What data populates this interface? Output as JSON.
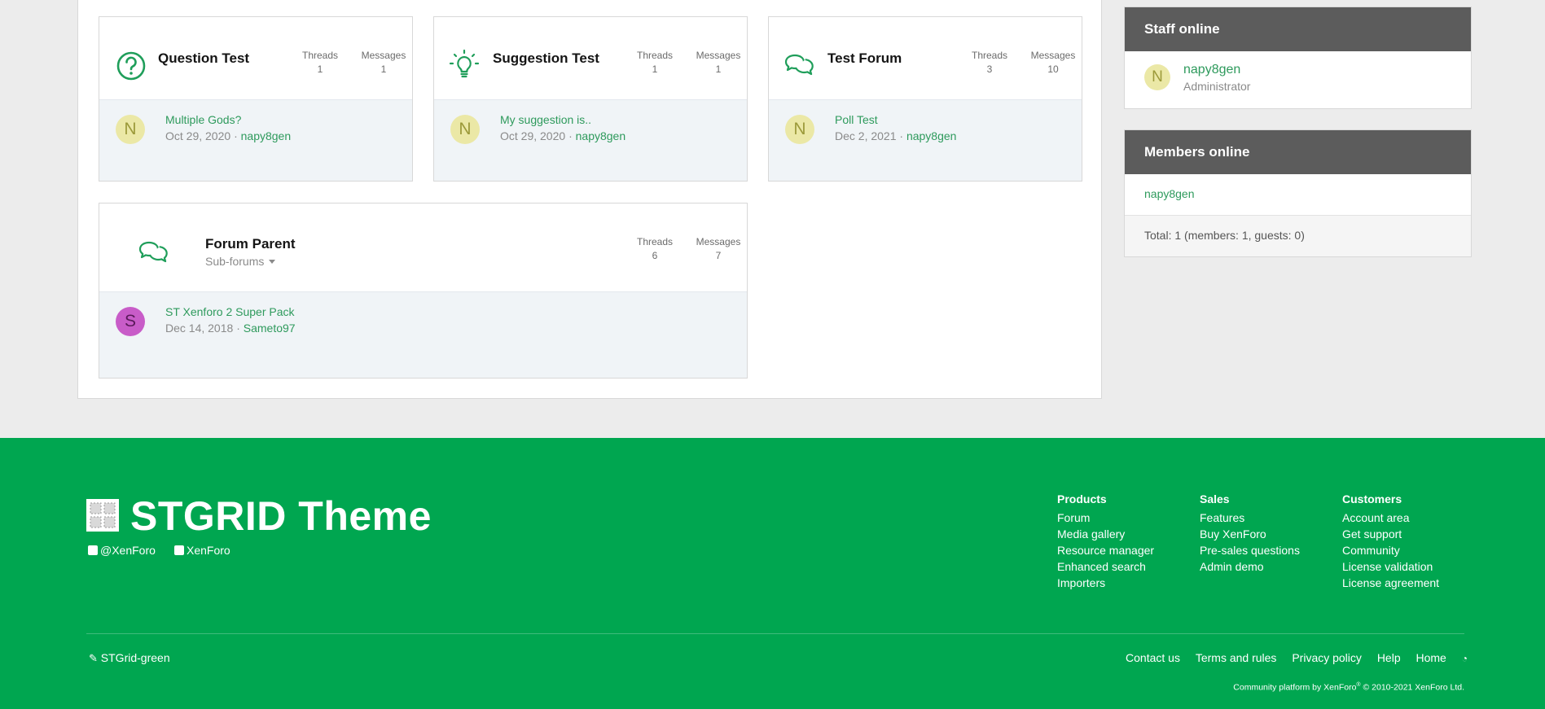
{
  "forums": [
    {
      "title": "Question Test",
      "threads_label": "Threads",
      "threads": "1",
      "messages_label": "Messages",
      "messages": "1",
      "last_title": "Multiple Gods?",
      "last_date": "Oct 29, 2020",
      "last_sep": "·",
      "last_user": "napy8gen",
      "avatar_letter": "N",
      "icon": "question-circle-icon"
    },
    {
      "title": "Suggestion Test",
      "threads_label": "Threads",
      "threads": "1",
      "messages_label": "Messages",
      "messages": "1",
      "last_title": "My suggestion is..",
      "last_date": "Oct 29, 2020",
      "last_sep": "·",
      "last_user": "napy8gen",
      "avatar_letter": "N",
      "icon": "lightbulb-icon"
    },
    {
      "title": "Test Forum",
      "threads_label": "Threads",
      "threads": "3",
      "messages_label": "Messages",
      "messages": "10",
      "last_title": "Poll Test",
      "last_date": "Dec 2, 2021",
      "last_sep": "·",
      "last_user": "napy8gen",
      "avatar_letter": "N",
      "icon": "chat-bubbles-icon"
    },
    {
      "title": "Forum Parent",
      "subforums": "Sub-forums",
      "threads_label": "Threads",
      "threads": "6",
      "messages_label": "Messages",
      "messages": "7",
      "last_title": "ST Xenforo 2 Super Pack",
      "last_date": "Dec 14, 2018",
      "last_sep": "·",
      "last_user": "Sameto97",
      "avatar_letter": "S",
      "icon": "chat-bubbles-icon"
    }
  ],
  "sidebar": {
    "staff_title": "Staff online",
    "staff_user": "napy8gen",
    "staff_role": "Administrator",
    "staff_avatar_letter": "N",
    "members_title": "Members online",
    "members_user": "napy8gen",
    "members_total": "Total: 1 (members: 1, guests: 0)"
  },
  "footer": {
    "logo_text": "STGRID Theme",
    "twitter": "@XenForo",
    "facebook": "XenForo",
    "columns": [
      {
        "heading": "Products",
        "links": [
          "Forum",
          "Media gallery",
          "Resource manager",
          "Enhanced search",
          "Importers"
        ]
      },
      {
        "heading": "Sales",
        "links": [
          "Features",
          "Buy XenForo",
          "Pre-sales questions",
          "Admin demo"
        ]
      },
      {
        "heading": "Customers",
        "links": [
          "Account area",
          "Get support",
          "Community",
          "License validation",
          "License agreement"
        ]
      }
    ],
    "style_name": "STGrid-green",
    "bottom_links": [
      "Contact us",
      "Terms and rules",
      "Privacy policy",
      "Help",
      "Home"
    ],
    "copyright_pre": "Community platform by XenForo",
    "copyright_reg": "®",
    "copyright_post": " © 2010-2021 XenForo Ltd.",
    "colors": {
      "footer_bg": "#00a650",
      "link": "#2e9a5c",
      "widget_head": "#5c5c5c"
    }
  }
}
